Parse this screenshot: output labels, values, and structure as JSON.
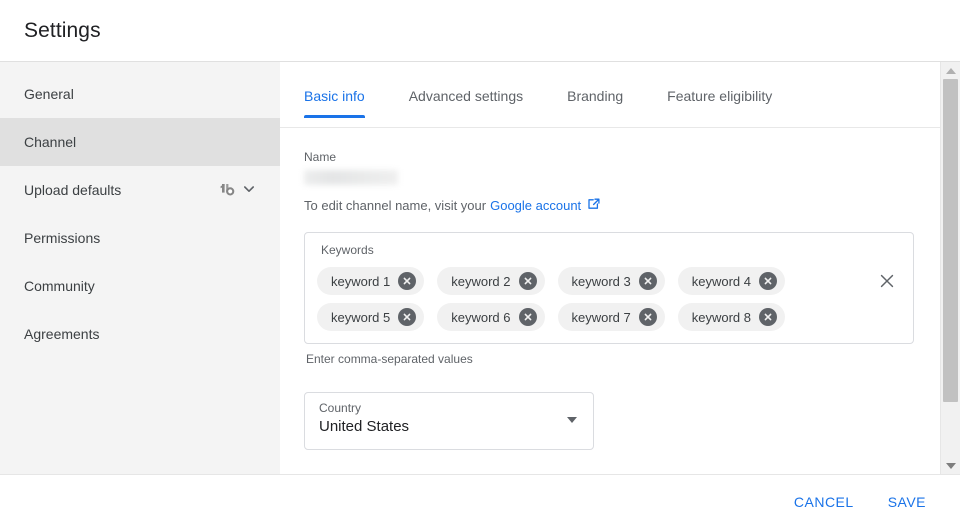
{
  "header": {
    "title": "Settings"
  },
  "sidebar": {
    "items": [
      {
        "label": "General",
        "active": false
      },
      {
        "label": "Channel",
        "active": true
      },
      {
        "label": "Upload defaults",
        "active": false,
        "badge_icon": "monetization-badge-icon",
        "chevron_icon": "chevron-down-icon"
      },
      {
        "label": "Permissions",
        "active": false
      },
      {
        "label": "Community",
        "active": false
      },
      {
        "label": "Agreements",
        "active": false
      }
    ]
  },
  "content": {
    "tabs": [
      {
        "label": "Basic info",
        "active": true
      },
      {
        "label": "Advanced settings",
        "active": false
      },
      {
        "label": "Branding",
        "active": false
      },
      {
        "label": "Feature eligibility",
        "active": false
      }
    ],
    "name_field": {
      "label": "Name",
      "value": "",
      "redacted": true
    },
    "edit_note": {
      "prefix": "To edit channel name, visit your",
      "link_text": "Google account",
      "link_icon": "external-link-icon"
    },
    "keywords": {
      "legend": "Keywords",
      "chips": [
        "keyword 1",
        "keyword 2",
        "keyword 3",
        "keyword 4",
        "keyword 5",
        "keyword 6",
        "keyword 7",
        "keyword 8"
      ],
      "chip_remove_icon": "close-circle-icon",
      "clear_icon": "close-icon",
      "hint": "Enter comma-separated values"
    },
    "country": {
      "label": "Country",
      "value": "United States",
      "arrow_icon": "dropdown-arrow-icon"
    }
  },
  "scrollbar": {
    "up_icon": "scroll-up-arrow-icon",
    "down_icon": "scroll-down-arrow-icon"
  },
  "footer": {
    "cancel_label": "CANCEL",
    "save_label": "SAVE"
  },
  "colors": {
    "accent": "#1a73e8",
    "sidebar_bg": "#f4f4f4",
    "sidebar_active_bg": "#e0e0e0",
    "text_primary": "#202124",
    "text_secondary": "#5f6368",
    "chip_bg": "#f1f1f1",
    "border": "#dadce0"
  }
}
